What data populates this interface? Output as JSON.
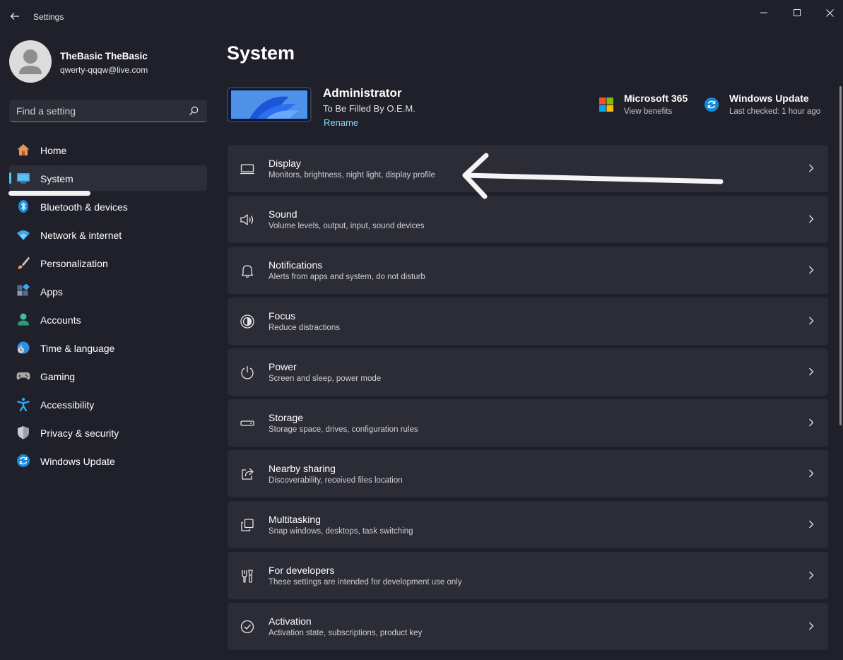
{
  "app": {
    "title": "Settings"
  },
  "profile": {
    "name": "TheBasic TheBasic",
    "email": "qwerty-qqqw@live.com"
  },
  "search": {
    "placeholder": "Find a setting"
  },
  "sidebar": {
    "items": [
      {
        "label": "Home",
        "icon": "home-icon"
      },
      {
        "label": "System",
        "icon": "system-icon",
        "active": true
      },
      {
        "label": "Bluetooth & devices",
        "icon": "bluetooth-icon"
      },
      {
        "label": "Network & internet",
        "icon": "wifi-icon"
      },
      {
        "label": "Personalization",
        "icon": "brush-icon"
      },
      {
        "label": "Apps",
        "icon": "apps-icon"
      },
      {
        "label": "Accounts",
        "icon": "accounts-icon"
      },
      {
        "label": "Time & language",
        "icon": "globe-clock-icon"
      },
      {
        "label": "Gaming",
        "icon": "gamepad-icon"
      },
      {
        "label": "Accessibility",
        "icon": "accessibility-icon"
      },
      {
        "label": "Privacy & security",
        "icon": "shield-icon"
      },
      {
        "label": "Windows Update",
        "icon": "update-icon"
      }
    ]
  },
  "main": {
    "title": "System",
    "device": {
      "name": "Administrator",
      "model": "To Be Filled By O.E.M.",
      "rename": "Rename"
    },
    "quick": [
      {
        "title": "Microsoft 365",
        "subtitle": "View benefits",
        "icon": "microsoft-logo-icon"
      },
      {
        "title": "Windows Update",
        "subtitle": "Last checked: 1 hour ago",
        "icon": "update-icon"
      }
    ],
    "settings": [
      {
        "title": "Display",
        "subtitle": "Monitors, brightness, night light, display profile",
        "icon": "display-icon"
      },
      {
        "title": "Sound",
        "subtitle": "Volume levels, output, input, sound devices",
        "icon": "speaker-icon"
      },
      {
        "title": "Notifications",
        "subtitle": "Alerts from apps and system, do not disturb",
        "icon": "bell-icon"
      },
      {
        "title": "Focus",
        "subtitle": "Reduce distractions",
        "icon": "focus-icon"
      },
      {
        "title": "Power",
        "subtitle": "Screen and sleep, power mode",
        "icon": "power-icon"
      },
      {
        "title": "Storage",
        "subtitle": "Storage space, drives, configuration rules",
        "icon": "storage-icon"
      },
      {
        "title": "Nearby sharing",
        "subtitle": "Discoverability, received files location",
        "icon": "share-icon"
      },
      {
        "title": "Multitasking",
        "subtitle": "Snap windows, desktops, task switching",
        "icon": "multitasking-icon"
      },
      {
        "title": "For developers",
        "subtitle": "These settings are intended for development use only",
        "icon": "developer-tools-icon"
      },
      {
        "title": "Activation",
        "subtitle": "Activation state, subscriptions, product key",
        "icon": "activation-check-icon"
      }
    ]
  },
  "colors": {
    "background": "#1f2029",
    "card": "#2b2c36",
    "accent": "#4cc2ff",
    "link": "#8fd3ff"
  }
}
